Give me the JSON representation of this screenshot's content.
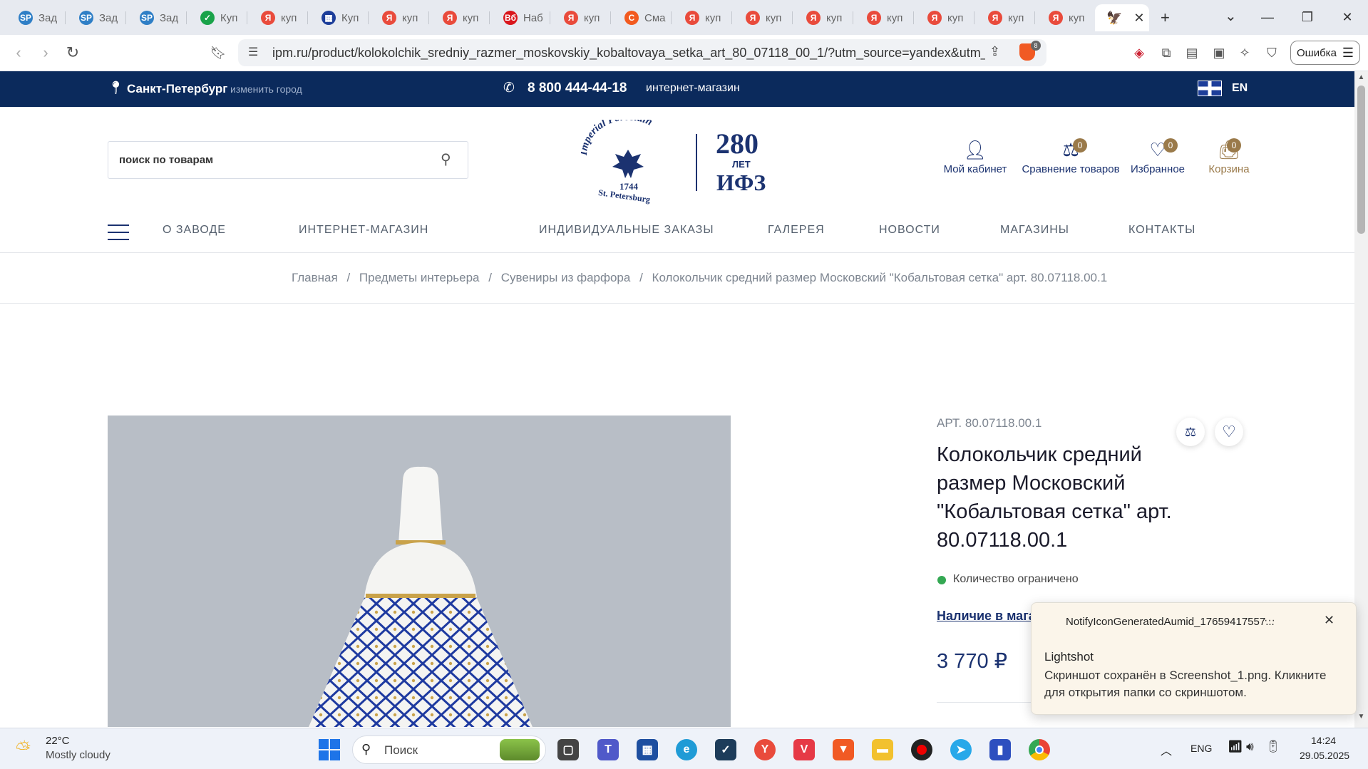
{
  "browser": {
    "tabs": [
      {
        "icon_text": "SP",
        "label": "Зад",
        "color": "#2f7fc6"
      },
      {
        "icon_text": "SP",
        "label": "Зад",
        "color": "#2f7fc6"
      },
      {
        "icon_text": "SP",
        "label": "Зад",
        "color": "#2f7fc6"
      },
      {
        "icon_text": "✓",
        "label": "Куп",
        "color": "#1aa34a"
      },
      {
        "icon_text": "Я",
        "label": "куп",
        "color": "#e94b3c"
      },
      {
        "icon_text": "▦",
        "label": "Куп",
        "color": "#1d3e9a"
      },
      {
        "icon_text": "Я",
        "label": "куп",
        "color": "#e94b3c"
      },
      {
        "icon_text": "Я",
        "label": "куп",
        "color": "#e94b3c"
      },
      {
        "icon_text": "Вб",
        "label": "Наб",
        "color": "#d9161c"
      },
      {
        "icon_text": "Я",
        "label": "куп",
        "color": "#e94b3c"
      },
      {
        "icon_text": "С",
        "label": "Сма",
        "color": "#f25a1f"
      },
      {
        "icon_text": "Я",
        "label": "куп",
        "color": "#e94b3c"
      },
      {
        "icon_text": "Я",
        "label": "куп",
        "color": "#e94b3c"
      },
      {
        "icon_text": "Я",
        "label": "куп",
        "color": "#e94b3c"
      },
      {
        "icon_text": "Я",
        "label": "куп",
        "color": "#e94b3c"
      },
      {
        "icon_text": "Я",
        "label": "куп",
        "color": "#e94b3c"
      },
      {
        "icon_text": "Я",
        "label": "куп",
        "color": "#e94b3c"
      },
      {
        "icon_text": "Я",
        "label": "куп",
        "color": "#e94b3c"
      }
    ],
    "url": "ipm.ru/product/kolokolchik_sredniy_razmer_moskovskiy_kobaltovaya_setka_art_80_07118_00_1/?utm_source=yandex&utm_m...",
    "error_button": "Ошибка",
    "shield_count": "8"
  },
  "site": {
    "city": "Санкт-Петербург",
    "change_city": "изменить город",
    "phone": "8 800 444-44-18",
    "phone_note": "интернет-магазин",
    "lang": "EN",
    "search_placeholder": "поиск по товарам",
    "logo": {
      "arc_text": "Imperial Porcelain",
      "year": "1744",
      "city": "St. Petersburg",
      "anniv": "280",
      "anniv_sub": "ЛЕТ",
      "anniv_name": "ИФЗ"
    },
    "header_icons": [
      {
        "label": "Мой кабинет",
        "badge": ""
      },
      {
        "label": "Сравнение товаров",
        "badge": "0"
      },
      {
        "label": "Избранное",
        "badge": "0"
      },
      {
        "label": "Корзина",
        "badge": "0"
      }
    ],
    "menu": [
      "О ЗАВОДЕ",
      "ИНТЕРНЕТ-МАГАЗИН",
      "ИНДИВИДУАЛЬНЫЕ ЗАКАЗЫ",
      "ГАЛЕРЕЯ",
      "НОВОСТИ",
      "МАГАЗИНЫ",
      "КОНТАКТЫ"
    ],
    "breadcrumb": [
      "Главная",
      "Предметы интерьера",
      "Сувениры из фарфора",
      "Колокольчик средний размер Московский \"Кобальтовая сетка\" арт. 80.07118.00.1"
    ],
    "breadcrumb_sep": "/"
  },
  "product": {
    "sku": "АРТ. 80.07118.00.1",
    "title_lines": [
      "Колокольчик средний",
      "размер Московский",
      "\"Кобальтовая сетка\" арт.",
      "80.07118.00.1"
    ],
    "stock": "Количество ограничено",
    "availability_link": "Наличие в мага",
    "price": "3 770 ₽"
  },
  "notification": {
    "app_id": "NotifyIconGeneratedAumid_17659417557...",
    "more": "···",
    "title": "Lightshot",
    "body": "Скриншот сохранён в Screenshot_1.png. Кликните для открытия папки со скриншотом."
  },
  "taskbar": {
    "temp": "22°C",
    "weather": "Mostly cloudy",
    "search": "Поиск",
    "lang": "ENG",
    "time": "14:24",
    "date": "29.05.2025"
  },
  "colors": {
    "brand": "#0b2a5c",
    "accent": "#1b3270",
    "gold": "#9a7a4a",
    "stock_green": "#34a853"
  }
}
